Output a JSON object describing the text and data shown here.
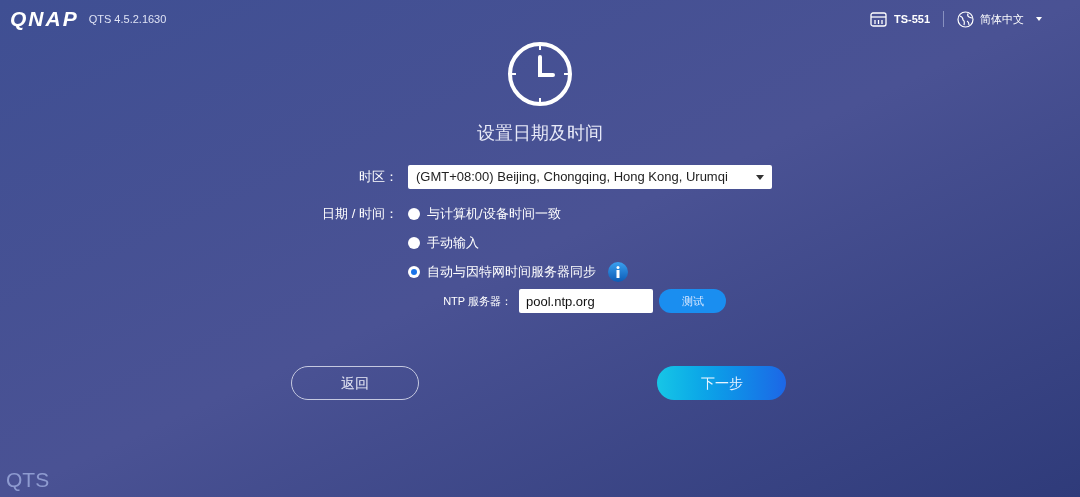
{
  "header": {
    "logo": "QNAP",
    "version": "QTS 4.5.2.1630",
    "device": "TS-551",
    "language": "简体中文"
  },
  "title": "设置日期及时间",
  "timezone": {
    "label": "时区：",
    "value": "(GMT+08:00) Beijing, Chongqing, Hong Kong, Urumqi"
  },
  "datetime": {
    "label": "日期 / 时间：",
    "options": [
      {
        "label": "与计算机/设备时间一致",
        "selected": false,
        "info": false
      },
      {
        "label": "手动输入",
        "selected": false,
        "info": false
      },
      {
        "label": "自动与因特网时间服务器同步",
        "selected": true,
        "info": true
      }
    ]
  },
  "ntp": {
    "label": "NTP 服务器：",
    "value": "pool.ntp.org",
    "button": "测试"
  },
  "buttons": {
    "back": "返回",
    "next": "下一步"
  },
  "footer": {
    "brand": "QTS"
  }
}
